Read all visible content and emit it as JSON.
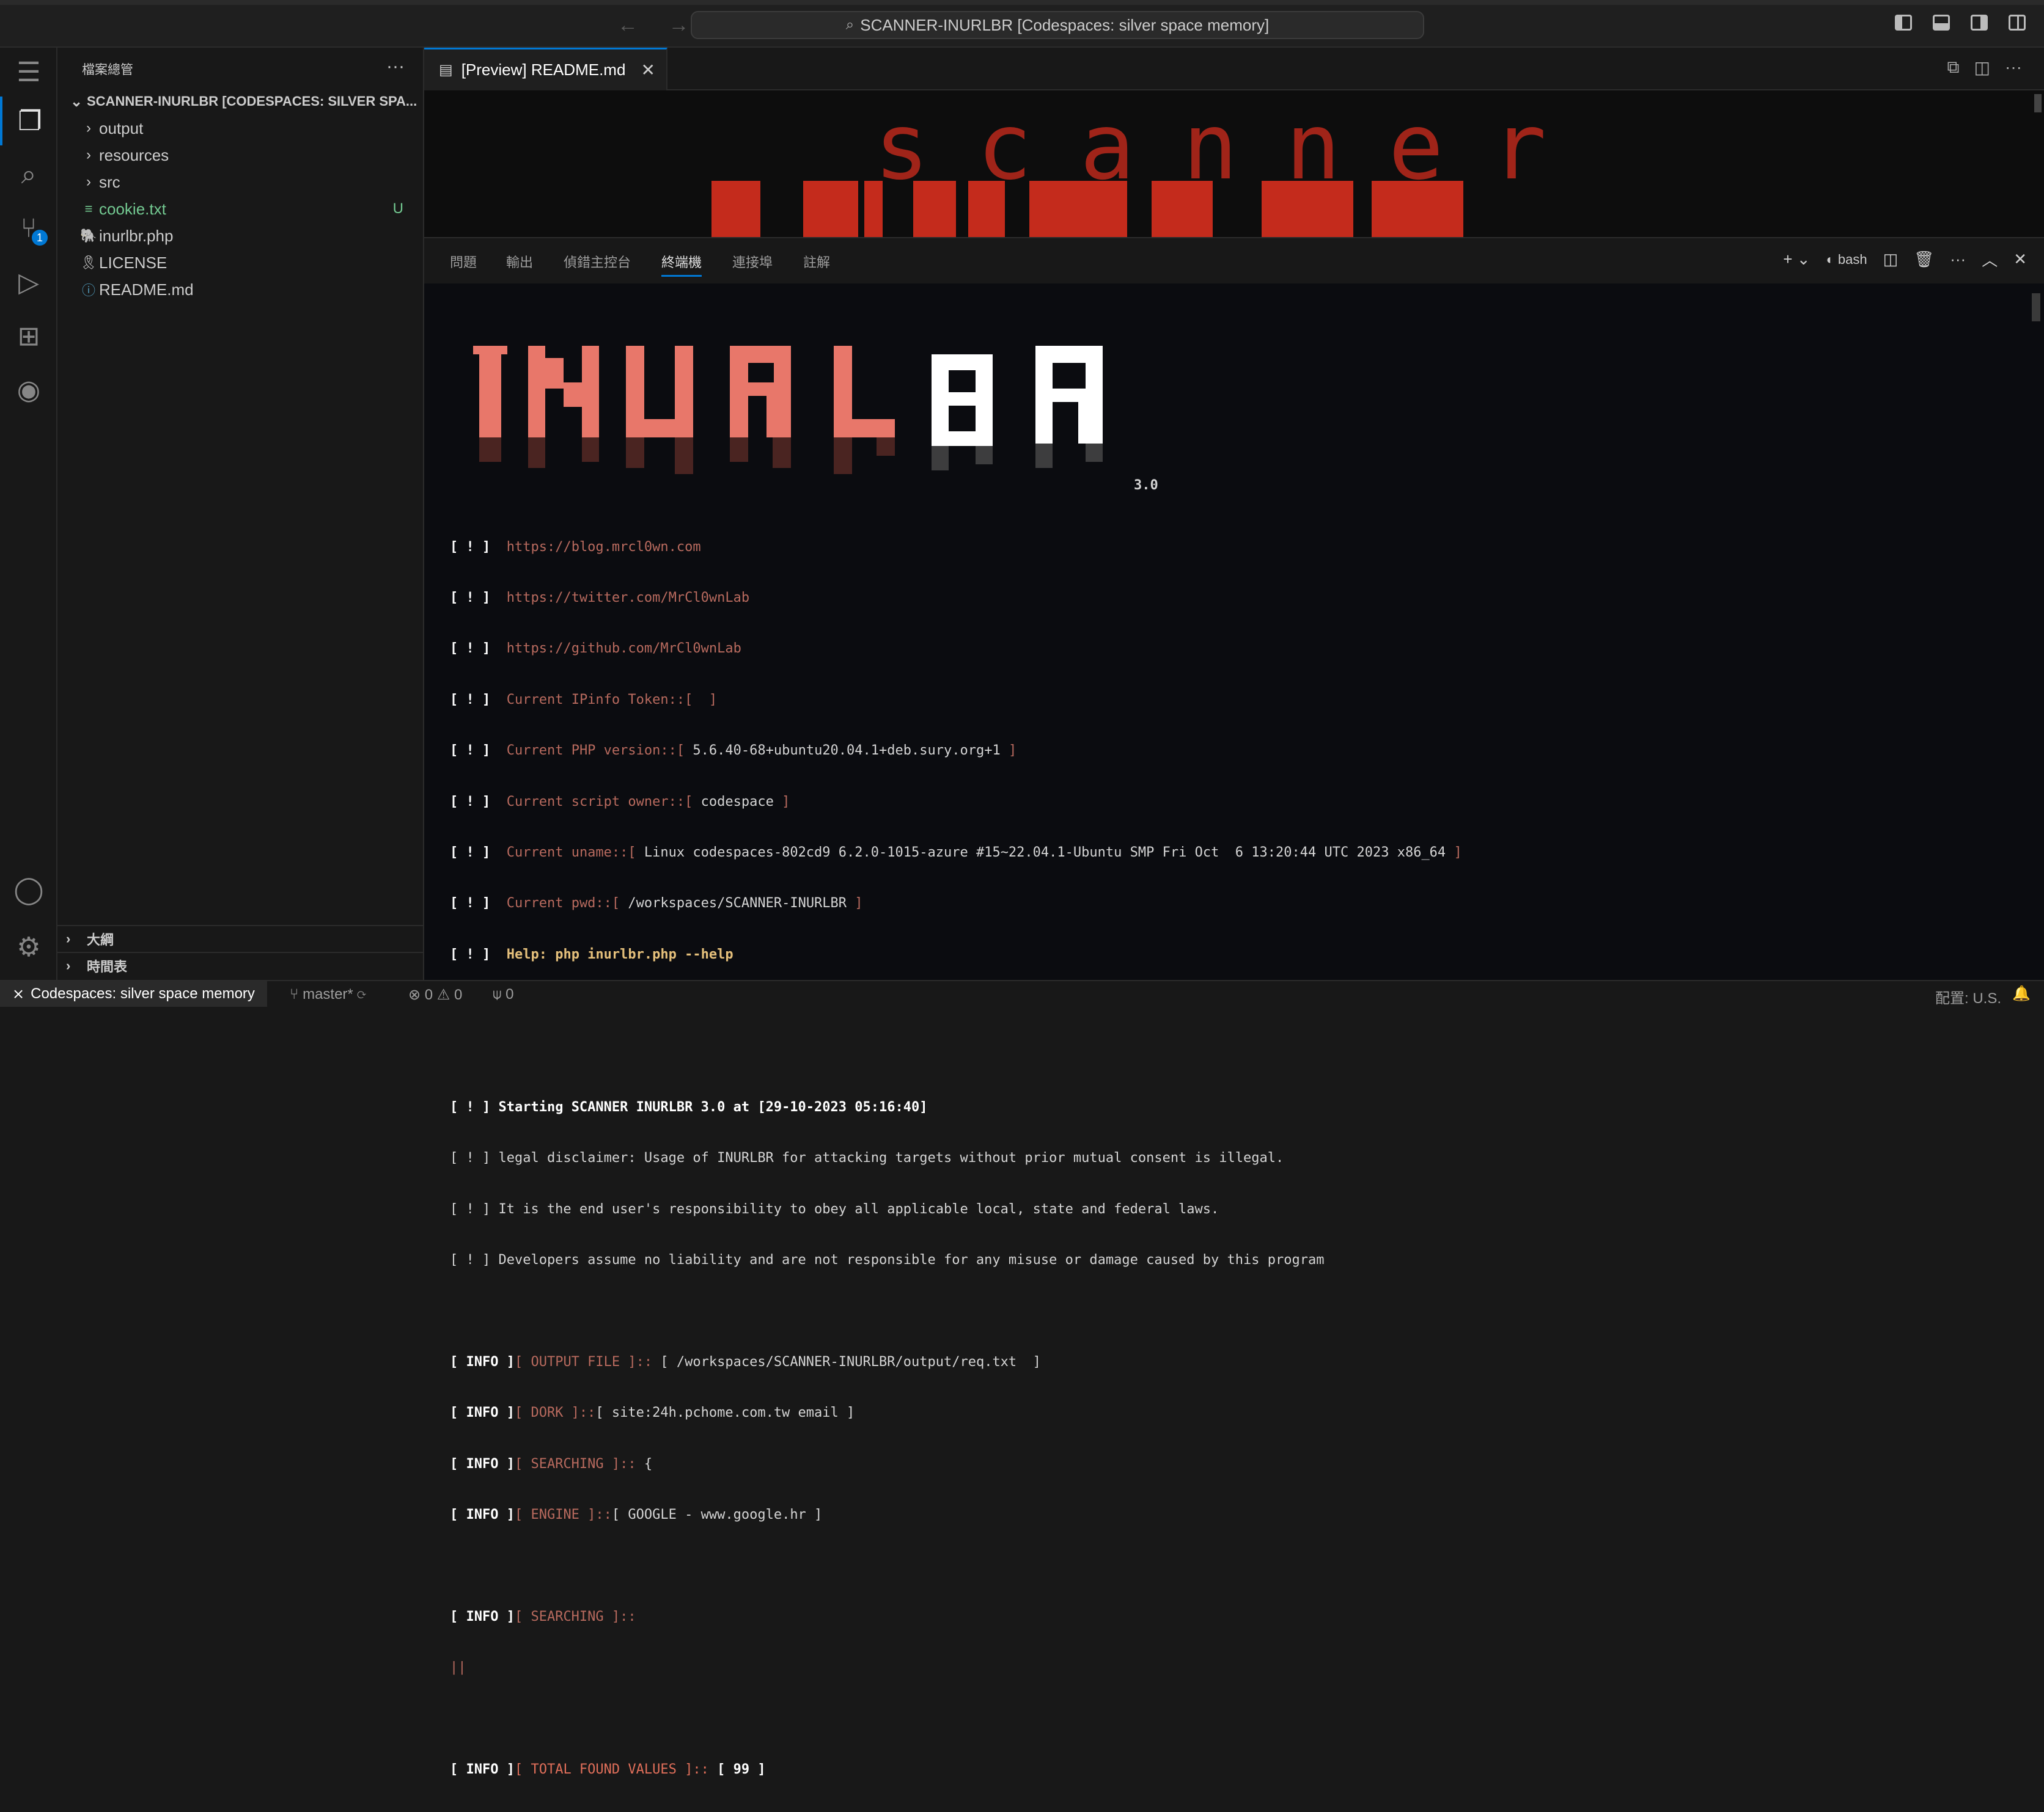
{
  "titlebar": {
    "nav_arrows": "← →",
    "command_center": "SCANNER-INURLBR [Codespaces: silver space memory]"
  },
  "activity": {
    "scm_badge": "1"
  },
  "sidebar": {
    "title": "檔案總管",
    "more": "···",
    "root": "SCANNER-INURLBR [CODESPACES: SILVER SPA...",
    "folders": [
      "output",
      "resources",
      "src"
    ],
    "files": [
      {
        "name": "cookie.txt",
        "status": "U",
        "icon": "≡"
      },
      {
        "name": "inurlbr.php",
        "status": "",
        "icon": "🐘"
      },
      {
        "name": "LICENSE",
        "status": "",
        "icon": "🎗"
      },
      {
        "name": "README.md",
        "status": "",
        "icon": "ⓘ"
      }
    ],
    "outline": "大綱",
    "timeline": "時間表"
  },
  "editor": {
    "tab_label": "[Preview] README.md",
    "preview_word": "scanner"
  },
  "panel": {
    "tabs": [
      "問題",
      "輸出",
      "偵錯主控台",
      "終端機",
      "連接埠",
      "註解"
    ],
    "active_tab": "終端機",
    "shell": "bash",
    "version": "3.0",
    "links": [
      {
        "tag": "[ ! ]",
        "text": "https://blog.mrcl0wn.com"
      },
      {
        "tag": "[ ! ]",
        "text": "https://twitter.com/MrCl0wnLab"
      },
      {
        "tag": "[ ! ]",
        "text": "https://github.com/MrCl0wnLab"
      }
    ],
    "info_lines": [
      {
        "tag": "[ ! ]",
        "label": "Current IPinfo Token::[",
        "value": " ",
        "end": "]"
      },
      {
        "tag": "[ ! ]",
        "label": "Current PHP version::[",
        "value": "5.6.40-68+ubuntu20.04.1+deb.sury.org+1",
        "end": "]"
      },
      {
        "tag": "[ ! ]",
        "label": "Current script owner::[",
        "value": "codespace",
        "end": "]"
      },
      {
        "tag": "[ ! ]",
        "label": "Current uname::[",
        "value": "Linux codespaces-802cd9 6.2.0-1015-azure #15~22.04.1-Ubuntu SMP Fri Oct  6 13:20:44 UTC 2023 x86_64",
        "end": "]"
      },
      {
        "tag": "[ ! ]",
        "label": "Current pwd::[",
        "value": "/workspaces/SCANNER-INURLBR",
        "end": "]"
      }
    ],
    "help": {
      "tag": "[ ! ]",
      "text": "Help: php inurlbr.php --help"
    },
    "separator": "------------------------------------------------------------------------------------------------------------------------",
    "start": {
      "tag": "[ ! ]",
      "text": "Starting SCANNER INURLBR 3.0 at [29-10-2023 05:16:40]"
    },
    "disclaimers": [
      "[ ! ] legal disclaimer: Usage of INURLBR for attacking targets without prior mutual consent is illegal.",
      "[ ! ] It is the end user's responsibility to obey all applicable local, state and federal laws.",
      "[ ! ] Developers assume no liability and are not responsible for any misuse or damage caused by this program"
    ],
    "info": [
      {
        "tag": "[ INFO ]",
        "label": "[ OUTPUT FILE ]::",
        "value": "[ /workspaces/SCANNER-INURLBR/output/req.txt  ]"
      },
      {
        "tag": "[ INFO ]",
        "label": "[ DORK ]::",
        "value": "[ site:24h.pchome.com.tw email ]"
      },
      {
        "tag": "[ INFO ]",
        "label": "[ SEARCHING ]::",
        "value": "{"
      },
      {
        "tag": "[ INFO ]",
        "label": "[ ENGINE ]::",
        "value": "[ GOOGLE - www.google.hr ]"
      }
    ],
    "searching2": {
      "tag": "[ INFO ]",
      "label": "[ SEARCHING ]::"
    },
    "progress": "||",
    "total": {
      "tag": "[ INFO ]",
      "label": "[ TOTAL FOUND VALUES ]::",
      "value": "[ 99 ]"
    }
  },
  "statusbar": {
    "remote": "Codespaces: silver space memory",
    "branch": "master*",
    "problems": "⊗ 0 ⚠ 0",
    "ports": "0",
    "locale": "配置: U.S."
  },
  "colors": {
    "accent": "#0078d4",
    "terminal_red": "#b86a5e",
    "logo_red": "#e8776a"
  }
}
